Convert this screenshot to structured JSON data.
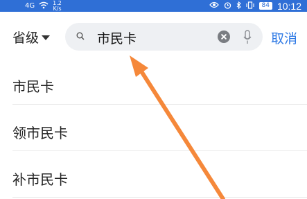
{
  "status_bar": {
    "signal": "4G",
    "speed": "1.2",
    "speed_unit": "K/s",
    "battery": "84",
    "time": "10:12"
  },
  "search": {
    "province_label": "省级",
    "query": "市民卡",
    "cancel_label": "取消"
  },
  "results": [
    {
      "label": "市民卡"
    },
    {
      "label": "领市民卡"
    },
    {
      "label": "补市民卡"
    }
  ],
  "colors": {
    "status_bar": "#2f6fd6",
    "accent": "#2f7ae5",
    "arrow": "#f5883a"
  }
}
